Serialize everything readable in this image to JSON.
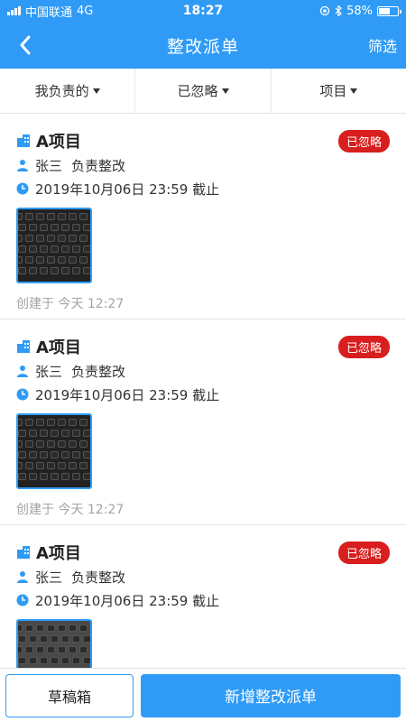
{
  "status_bar": {
    "carrier": "中国联通",
    "network": "4G",
    "time": "18:27",
    "battery": "58%",
    "battery_level": 0.58
  },
  "nav": {
    "title": "整改派单",
    "filter_label": "筛选"
  },
  "tabs": [
    {
      "label": "我负责的"
    },
    {
      "label": "已忽略"
    },
    {
      "label": "项目"
    }
  ],
  "cards": [
    {
      "project": "A项目",
      "status": "已忽略",
      "assignee": "张三",
      "task": "负责整改",
      "deadline": "2019年10月06日 23:59 截止",
      "created": "创建于 今天 12:27"
    },
    {
      "project": "A项目",
      "status": "已忽略",
      "assignee": "张三",
      "task": "负责整改",
      "deadline": "2019年10月06日 23:59 截止",
      "created": "创建于 今天 12:27"
    },
    {
      "project": "A项目",
      "status": "已忽略",
      "assignee": "张三",
      "task": "负责整改",
      "deadline": "2019年10月06日 23:59 截止",
      "created": ""
    }
  ],
  "bottom": {
    "draft_label": "草稿箱",
    "new_label": "新增整改派单"
  },
  "colors": {
    "primary": "#2f9bf6",
    "badge_red": "#d81e1e"
  }
}
